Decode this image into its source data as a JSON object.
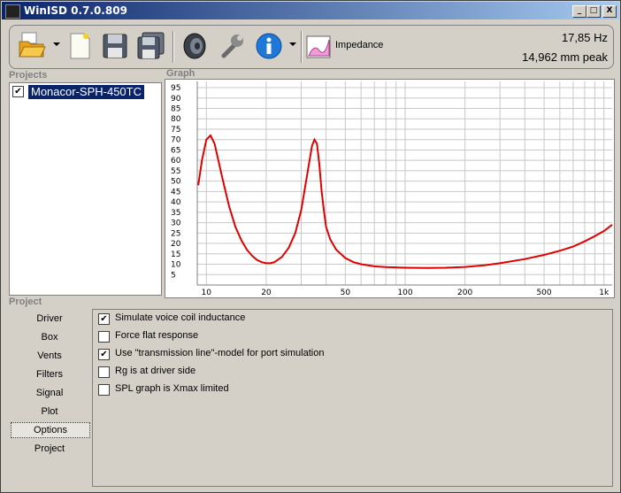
{
  "window": {
    "title": "WinISD 0.7.0.809",
    "buttons": [
      "_",
      "□",
      "X"
    ]
  },
  "toolbar": {
    "items": [
      "open-icon",
      "new-icon",
      "save-icon",
      "save-all-icon",
      "speaker-icon",
      "wrench-icon",
      "info-icon",
      "graph-icon"
    ],
    "graph_label": "Impedance",
    "readout_freq": "17,85 Hz",
    "readout_peak": "14,962 mm peak"
  },
  "projects": {
    "label": "Projects",
    "items": [
      {
        "name": "Monacor-SPH-450TC",
        "checked": true
      }
    ]
  },
  "graph": {
    "label": "Graph"
  },
  "chart_data": {
    "type": "line",
    "title": "",
    "xlabel": "",
    "ylabel": "",
    "x_scale": "log",
    "xlim": [
      9,
      1100
    ],
    "ylim": [
      0,
      98
    ],
    "x_ticks": [
      "10",
      "20",
      "50",
      "100",
      "200",
      "500",
      "1k"
    ],
    "y_ticks": [
      "5",
      "10",
      "15",
      "20",
      "25",
      "30",
      "35",
      "40",
      "45",
      "50",
      "55",
      "60",
      "65",
      "70",
      "75",
      "80",
      "85",
      "90",
      "95"
    ],
    "grid": true,
    "series": [
      {
        "color": "#e00000",
        "x": [
          9.1,
          9.5,
          10,
          10.5,
          11,
          12,
          13,
          14,
          15,
          16,
          17,
          18,
          19,
          20,
          21,
          22,
          24,
          26,
          28,
          30,
          32,
          34,
          35,
          36,
          37,
          38,
          39,
          40,
          42,
          45,
          50,
          55,
          60,
          70,
          80,
          100,
          130,
          160,
          200,
          250,
          300,
          400,
          500,
          600,
          700,
          800,
          900,
          1000,
          1100
        ],
        "y": [
          48,
          60,
          70,
          72,
          68,
          52,
          38,
          28,
          21.5,
          17,
          14,
          12,
          11,
          10.5,
          10.5,
          11,
          13.5,
          18,
          25,
          36,
          52,
          67,
          70,
          68,
          58,
          45,
          36,
          28,
          22,
          17,
          13,
          11,
          10,
          9,
          8.6,
          8.3,
          8.2,
          8.3,
          8.7,
          9.5,
          10.5,
          12.5,
          14.5,
          16.5,
          18.5,
          21,
          23.5,
          26,
          29
        ]
      }
    ]
  },
  "project_section": {
    "label": "Project",
    "nav": [
      "Driver",
      "Box",
      "Vents",
      "Filters",
      "Signal",
      "Plot",
      "Options",
      "Project"
    ],
    "active": "Options"
  },
  "options": [
    {
      "label": "Simulate voice coil inductance",
      "checked": true
    },
    {
      "label": "Force flat response",
      "checked": false
    },
    {
      "label": "Use \"transmission line\"-model for port simulation",
      "checked": true
    },
    {
      "label": "Rg is at driver side",
      "checked": false
    },
    {
      "label": "SPL graph is Xmax limited",
      "checked": false
    }
  ]
}
